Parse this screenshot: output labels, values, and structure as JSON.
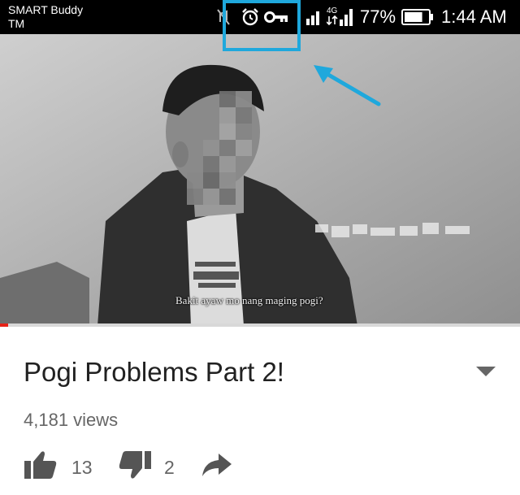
{
  "status_bar": {
    "carrier_line1": "SMART Buddy",
    "carrier_line2": "TM",
    "network_type": "4G",
    "battery_percent": "77%",
    "battery_level": 0.77,
    "time": "1:44 AM",
    "icons": [
      "mute-icon",
      "alarm-icon",
      "vpn-key-icon",
      "signal-icon",
      "signal-4g-icon",
      "battery-icon"
    ]
  },
  "video": {
    "subtitle": "Bakit ayaw mo nang maging pogi?",
    "progress": 0.015,
    "progress_color": "#e62117"
  },
  "annotation": {
    "highlight_color": "#1fa8dc"
  },
  "info": {
    "title": "Pogi Problems Part 2!",
    "views": "4,181 views",
    "likes": "13",
    "dislikes": "2"
  }
}
